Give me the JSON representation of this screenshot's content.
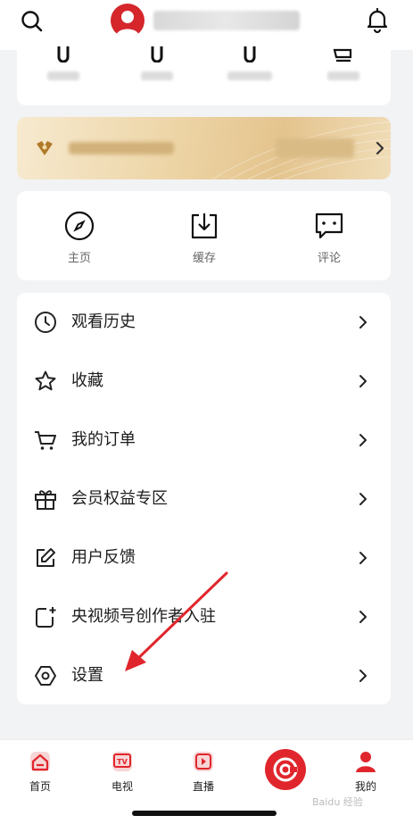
{
  "header": {
    "search_icon": "search-icon",
    "bell_icon": "bell-icon"
  },
  "quick_access": [
    {
      "label": "主页",
      "icon": "compass-icon"
    },
    {
      "label": "缓存",
      "icon": "download-icon"
    },
    {
      "label": "评论",
      "icon": "comment-icon"
    }
  ],
  "menu": [
    {
      "label": "观看历史",
      "icon": "clock-icon"
    },
    {
      "label": "收藏",
      "icon": "star-icon"
    },
    {
      "label": "我的订单",
      "icon": "cart-icon"
    },
    {
      "label": "会员权益专区",
      "icon": "gift-icon"
    },
    {
      "label": "用户反馈",
      "icon": "edit-icon"
    },
    {
      "label": "央视频号创作者入驻",
      "icon": "creator-icon"
    },
    {
      "label": "设置",
      "icon": "settings-icon"
    }
  ],
  "bottom_nav": [
    {
      "label": "首页",
      "icon": "home-icon"
    },
    {
      "label": "电视",
      "icon": "tv-icon"
    },
    {
      "label": "直播",
      "icon": "live-icon"
    },
    {
      "label": "",
      "icon": "center-logo-icon"
    },
    {
      "label": "我的",
      "icon": "profile-icon"
    }
  ],
  "colors": {
    "accent": "#e0262c",
    "background": "#f2f3f5",
    "vip_gold": "#e4c48e"
  },
  "watermark": "Baidu 经验"
}
